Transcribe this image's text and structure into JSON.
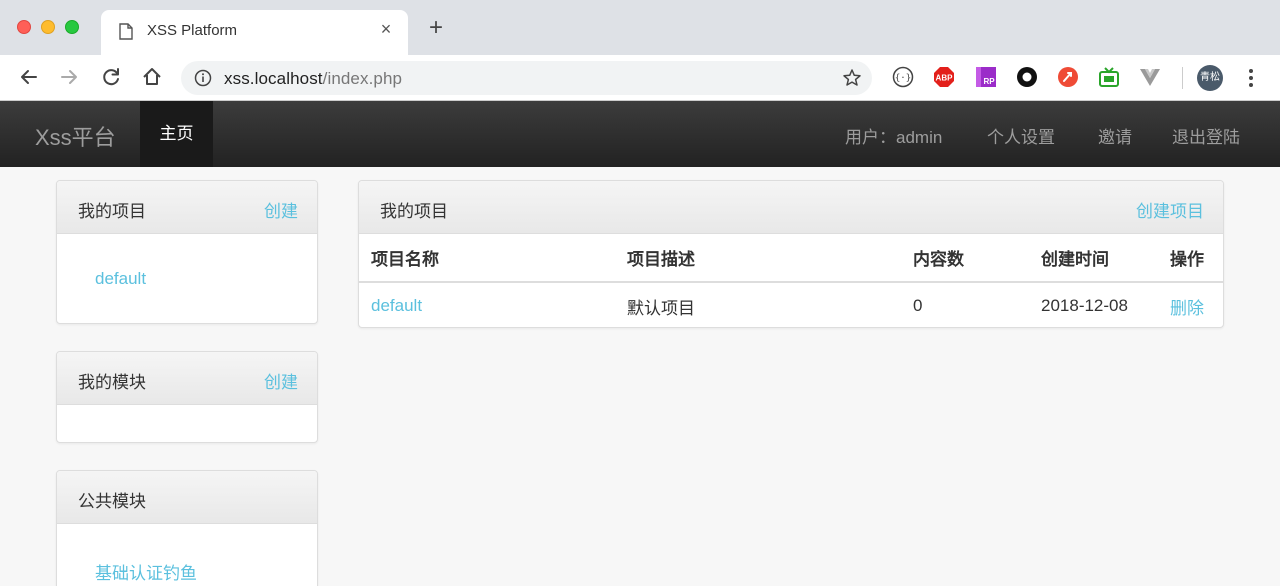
{
  "browser": {
    "tab_title": "XSS Platform",
    "tab_close": "×",
    "new_tab": "+",
    "url_host": "xss.localhost",
    "url_path": "/index.php",
    "profile_label": "青松"
  },
  "navbar": {
    "brand": "Xss平台",
    "home": "主页",
    "user": "用户：admin",
    "settings": "个人设置",
    "invite": "邀请",
    "logout": "退出登陆"
  },
  "sidebar": {
    "my_projects": {
      "title": "我的项目",
      "action": "创建",
      "items": [
        "default"
      ]
    },
    "my_modules": {
      "title": "我的模块",
      "action": "创建"
    },
    "public_modules": {
      "title": "公共模块",
      "items": [
        "基础认证钓鱼"
      ]
    }
  },
  "main": {
    "title": "我的项目",
    "action": "创建项目",
    "columns": [
      "项目名称",
      "项目描述",
      "内容数",
      "创建时间",
      "操作"
    ],
    "rows": [
      {
        "name": "default",
        "description": "默认项目",
        "count": "0",
        "created": "2018-12-08",
        "op": "删除"
      }
    ]
  },
  "colors": {
    "accent": "#5bc0de",
    "navbar": "#222222",
    "background": "#f7f7f7"
  }
}
